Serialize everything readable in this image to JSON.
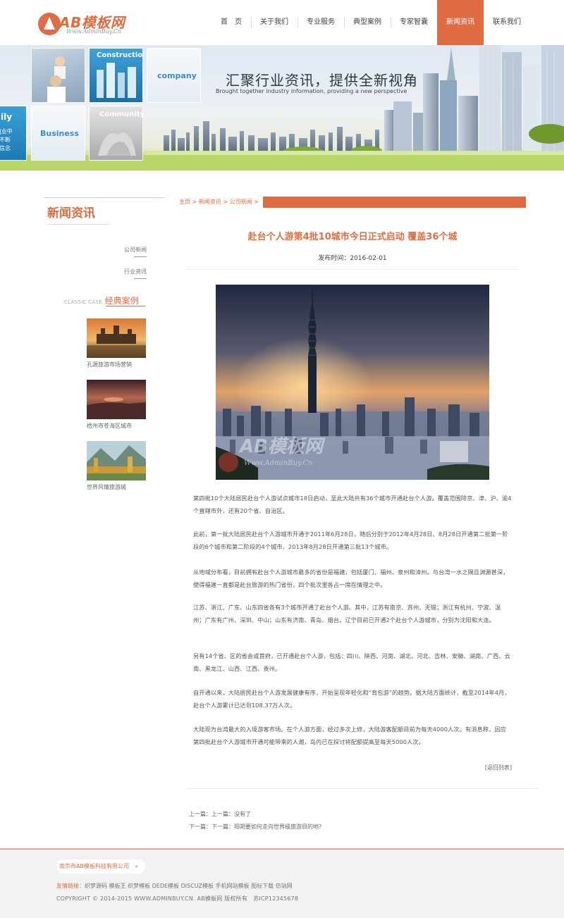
{
  "header": {
    "logo_text": "AB模板网",
    "logo_sub": "Www.AdminBuy.Cn",
    "nav": [
      {
        "label": "首　页"
      },
      {
        "label": "关于我们"
      },
      {
        "label": "专业服务"
      },
      {
        "label": "典型案例"
      },
      {
        "label": "专家智囊"
      },
      {
        "label": "新闻资讯",
        "active": true
      },
      {
        "label": "联系我们"
      }
    ]
  },
  "banner": {
    "slogan": "汇聚行业资讯，提供全新视角",
    "sub": "Brought together industry information, providing a new perspective",
    "tiles": {
      "construction": "Construction",
      "company": "company",
      "community": "Community",
      "business": "Business",
      "edge_label": "ily",
      "edge_text": [
        "|业中",
        "不断",
        "信念"
      ]
    }
  },
  "sidebar": {
    "title": "新闻资讯",
    "links": [
      "公司新闻",
      "行业资讯"
    ],
    "case_en": "CLASSIC CASE",
    "case_cn": "经典案例",
    "cases": [
      {
        "caption": "孔源旅游市场营销"
      },
      {
        "caption": "梧州市苍海区城市"
      },
      {
        "caption": "世界风情旅游城"
      }
    ]
  },
  "main": {
    "breadcrumb": "主页 > 新闻资讯 > 公司新闻 >",
    "title": "赴台个人游第4批10城市今日正式启动 覆盖36个城",
    "date": "发布时间：2016-02-01",
    "watermark": "AB模板网",
    "watermark_sub": "Www.AdminBuy.Cn",
    "paragraphs": [
      "第四批10个大陆居民赴台个人游试点城市18日启动，至此大陆共有36个城市开通赴台个人游。覆盖范围除京、津、沪、渝4个直辖市外，还有20个省、自治区。",
      "此前，第一批大陆居民赴台个人游城市开通于2011年6月28日，随后分别于2012年4月28日、8月28日开通第二批第一阶段的6个城市和第二阶段的4个城市，2013年8月28日开通第三批13个城市。",
      "从地域分布看，目前拥有赴台个人游城市最多的省份是福建，包括厦门、福州、泉州和漳州。与台湾一水之隔且渊源甚深，使得福建一直都是赴台旅游的热门省份，四个批次里各占一席在情理之中。",
      "江苏、浙江、广东、山东四省各有3个城市开通了赴台个人游。其中，江苏有南京、苏州、无锡；浙江有杭州、宁波、温州；广东有广州、深圳、中山；山东有济南、青岛、烟台。辽宁目前已开通2个赴台个人游城市，分别为沈阳和大连。",
      "另有14个省、区的省会或首府，已开通赴台个人游，包括：四川、陕西、河南、湖北、河北、吉林、安徽、湖南、广西、云南、黑龙江、山西、江西、贵州。",
      "自开通以来，大陆居民赴台个人游发展健康有序，开始呈现年轻化和“背包游”的趋势。据大陆方面统计，截至2014年4月，赴台个人游累计已达到108.37万人次。",
      "大陆现为台湾最大的入境游客市场。在个人游方面，经过多次上修，大陆游客配额目前为每天4000人次。有消息称，因应第四批赴台个人游城市开通可能带来的人潮，岛内已在探讨将配额提高至每天5000人次。"
    ],
    "back_link": "[返回列表]",
    "prev": "上一篇：上一篇：没有了",
    "next": "下一篇：下一篇：阳朔要如何走向世界级旅游目的地？"
  },
  "footer": {
    "company": "南京市AB模板科技有限公司　»",
    "links_label": "友情链接：",
    "links": "织梦源码  模板王  织梦模板  DEDE模板  DISCUZ模板  手机网站模板  图标下载  仿站网",
    "copyright": "COPYRIGHT © 2014-2015 WWW.ADMINBUY.CN. AB模板网 版权所有　苏ICP12345678"
  }
}
